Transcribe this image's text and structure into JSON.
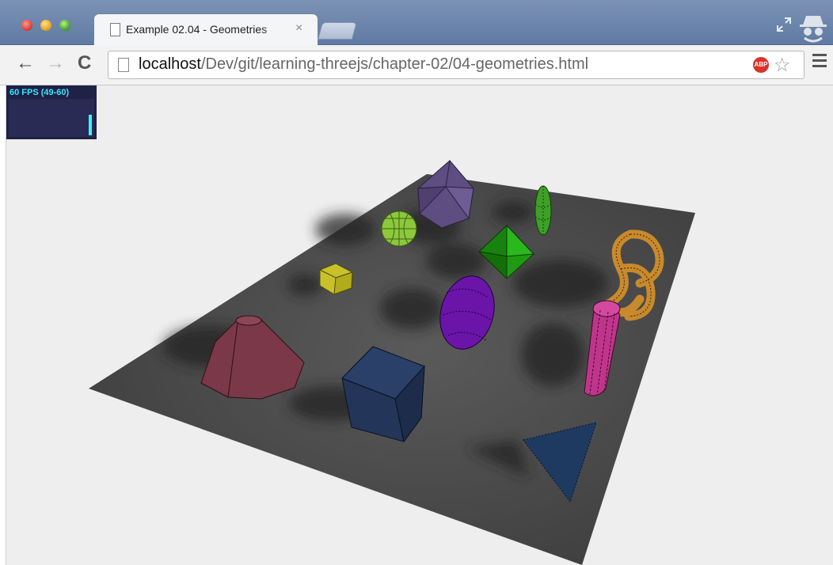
{
  "browser": {
    "tab_title": "Example 02.04 - Geometries",
    "tab_close": "×",
    "url_host": "localhost",
    "url_path": "/Dev/git/learning-threejs/chapter-02/04-geometries.html",
    "back_glyph": "←",
    "forward_glyph": "→",
    "reload_glyph": "C",
    "star_glyph": "☆",
    "abp_label": "ABP"
  },
  "stats": {
    "fps_label": "60 FPS (49-60)"
  },
  "scene": {
    "objects": [
      {
        "name": "icosahedron",
        "color": "#5e4d80"
      },
      {
        "name": "sphere",
        "color": "#8cc83c"
      },
      {
        "name": "thin-ellipsoid",
        "color": "#3ea028"
      },
      {
        "name": "octahedron",
        "color": "#1f9a12"
      },
      {
        "name": "small-cube",
        "color": "#c9c12a"
      },
      {
        "name": "ellipsoid",
        "color": "#6a14a8"
      },
      {
        "name": "torus-knot",
        "color": "#c88a2c"
      },
      {
        "name": "cylinder",
        "color": "#c0358c"
      },
      {
        "name": "cone",
        "color": "#7a3848"
      },
      {
        "name": "large-cube",
        "color": "#233558"
      },
      {
        "name": "triangle",
        "color": "#1e3a60"
      }
    ]
  }
}
